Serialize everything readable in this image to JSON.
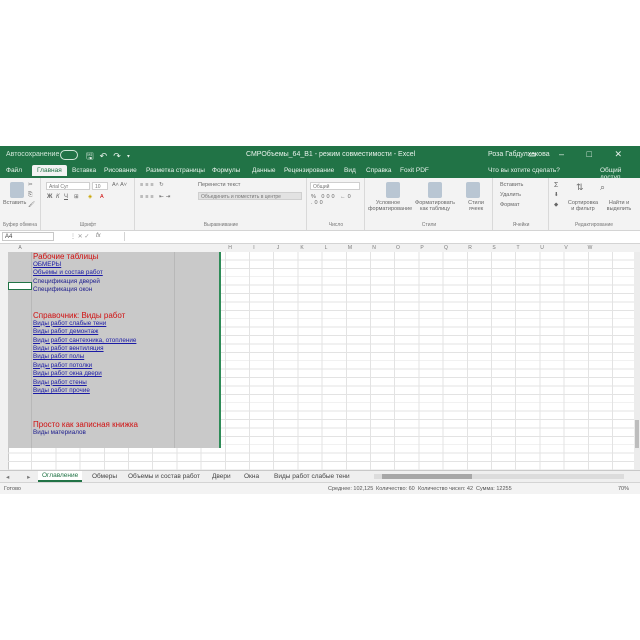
{
  "titlebar": {
    "autosave": "Автосохранение",
    "title": "СМРОбъемы_64_В1  -  режим совместимости  -  Excel",
    "user": "Роза Габдулхакова",
    "window_buttons": "▭ – □ ✕"
  },
  "ribbon_tabs": [
    "Файл",
    "Главная",
    "Вставка",
    "Рисование",
    "Разметка страницы",
    "Формулы",
    "Данные",
    "Рецензирование",
    "Вид",
    "Справка",
    "Foxit PDF"
  ],
  "tellme": "Что вы хотите сделать?",
  "share": "Общий доступ",
  "ribbon": {
    "paste": "Вставить",
    "font_name": "Arial Cyr",
    "font_size": "10",
    "wrap_text": "Перенести текст",
    "merge": "Объединить и поместить в центре",
    "number_format": "Общий",
    "cond_format": "Условное форматирование",
    "format_table": "Форматировать как таблицу",
    "cell_styles": "Стили ячеек",
    "insert": "Вставить",
    "delete": "Удалить",
    "format": "Формат",
    "sort": "Сортировка и фильтр",
    "find": "Найти и выделить",
    "groups": [
      "Буфер обмена",
      "Шрифт",
      "Выравнивание",
      "Число",
      "Стили",
      "Ячейки",
      "Редактирование"
    ]
  },
  "formula_bar": {
    "name_box": "A4",
    "fx": "fx",
    "symbols": "⋮  ✕  ✓",
    "content": ""
  },
  "columns": [
    "A",
    "",
    "",
    "",
    "",
    "",
    "",
    "",
    "",
    "H",
    "I",
    "J",
    "K",
    "L",
    "M",
    "N",
    "O",
    "P",
    "Q",
    "R",
    "S",
    "T",
    "U",
    "V",
    "W"
  ],
  "contents": [
    {
      "text": "Рабочие таблицы",
      "style": "head",
      "row": 1
    },
    {
      "text": "ОБМЕРЫ",
      "style": "link",
      "row": 2
    },
    {
      "text": "Объемы и состав работ",
      "style": "link",
      "row": 3
    },
    {
      "text": "Спецификация дверей",
      "style": "plain",
      "row": 4
    },
    {
      "text": "Спецификация окон",
      "style": "plain",
      "row": 5
    },
    {
      "text": "Справочник: Виды работ",
      "style": "head",
      "row": 8
    },
    {
      "text": "Виды работ слабые тени",
      "style": "link",
      "row": 9
    },
    {
      "text": "Виды работ демонтаж",
      "style": "link",
      "row": 10
    },
    {
      "text": "Виды работ сантехника, отопление",
      "style": "link",
      "row": 11
    },
    {
      "text": "Виды работ вентиляция",
      "style": "link",
      "row": 12
    },
    {
      "text": "Виды работ полы",
      "style": "link",
      "row": 13
    },
    {
      "text": "Виды работ потолки",
      "style": "link",
      "row": 14
    },
    {
      "text": "Виды работ окна двери",
      "style": "link",
      "row": 15
    },
    {
      "text": "Виды работ стены",
      "style": "link",
      "row": 16
    },
    {
      "text": "Виды работ прочие",
      "style": "link",
      "row": 17
    },
    {
      "text": "Просто как записная книжка",
      "style": "head",
      "row": 21
    },
    {
      "text": "Виды материалов",
      "style": "plain",
      "row": 22
    }
  ],
  "sheet_tabs": [
    "Оглавление",
    "Обмеры",
    "Объемы и состав работ",
    "Двери",
    "Окна",
    "Виды работ слабые тени"
  ],
  "active_sheet": "Оглавление",
  "status": {
    "ready": "Готово",
    "average": "Среднее: 102,125",
    "count": "Количество: 60",
    "numcount": "Количество чисел: 42",
    "sum": "Сумма: 12255",
    "zoom": "70%"
  },
  "colors": {
    "excel_green": "#217346",
    "heading_red": "#d01010",
    "link_blue": "#1a1aa6"
  }
}
